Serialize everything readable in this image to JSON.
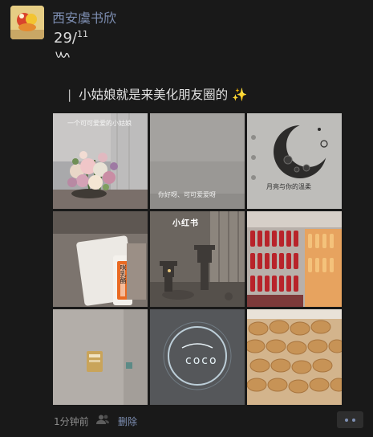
{
  "post": {
    "username": "西安虞书欣",
    "date_day": "29/",
    "date_month": "11",
    "caption_bar": "|",
    "caption_text": "小姑娘就是来美化朋友圈的",
    "caption_emoji": "✨"
  },
  "photos": [
    {
      "name": "flowers",
      "text": "一个可可爱爱的小姑娘"
    },
    {
      "name": "plain-wall",
      "text": "你好呀、可可爱爱呀"
    },
    {
      "name": "moon-drawing",
      "text": "月亮与你的温柔"
    },
    {
      "name": "milk-tea",
      "text": "咪乳酪"
    },
    {
      "name": "stone-lanterns",
      "text": "小红书"
    },
    {
      "name": "cola-fridge",
      "text": ""
    },
    {
      "name": "wall-sign",
      "text": ""
    },
    {
      "name": "neon-sign",
      "text": "coco"
    },
    {
      "name": "bread-tray",
      "text": ""
    }
  ],
  "footer": {
    "time": "1分钟前",
    "delete_label": "删除",
    "friends_icon": "friends-icon",
    "more_icon": "more-dots-icon"
  },
  "colors": {
    "background": "#191919",
    "link_blue": "#7e8fb3",
    "text": "#e8e8e8",
    "muted": "#8d8d8d"
  }
}
